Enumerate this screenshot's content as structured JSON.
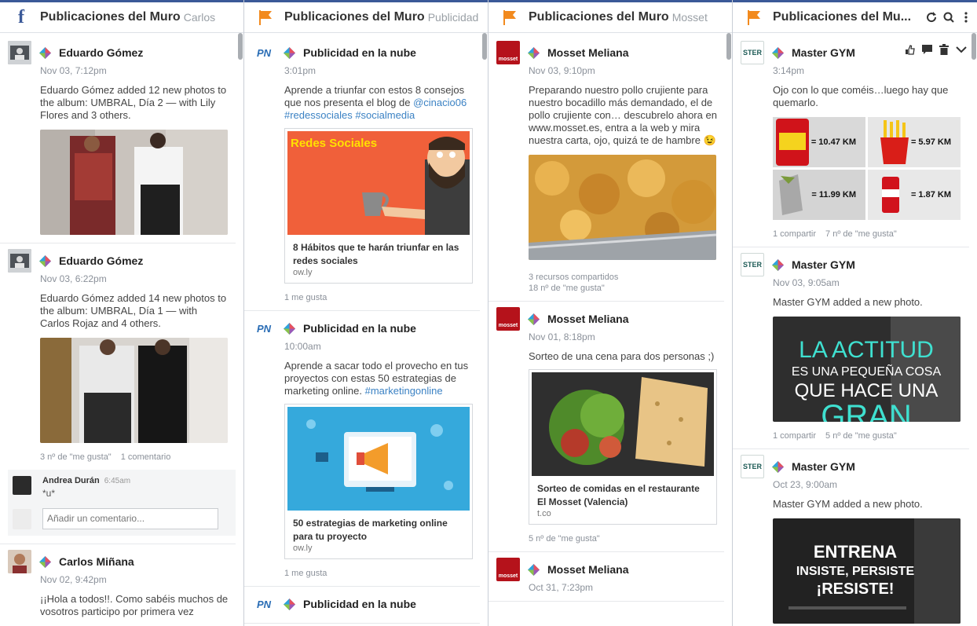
{
  "columns": [
    {
      "icon": "facebook-icon",
      "title": "Publicaciones del Muro",
      "subtitle": "Carlos",
      "posts": [
        {
          "author": "Eduardo Gómez",
          "time": "Nov 03, 7:12pm",
          "text": "Eduardo Gómez added 12 new photos to the album: UMBRAL, Día 2 — with Lily Flores and 3 others."
        },
        {
          "author": "Eduardo Gómez",
          "time": "Nov 03, 6:22pm",
          "text": "Eduardo Gómez added 14 new photos to the album: UMBRAL, Día 1 — with Carlos Rojaz and 4 others.",
          "likes": "3 nº de \"me gusta\"",
          "comments": "1 comentario",
          "comment": {
            "name": "Andrea Durán",
            "time": "6:45am",
            "text": "*u*"
          },
          "comment_placeholder": "Añadir un comentario..."
        },
        {
          "author": "Carlos Miñana",
          "time": "Nov 02, 9:42pm",
          "text": "¡¡Hola a todos!!. Como sabéis muchos de vosotros participo por primera vez"
        }
      ]
    },
    {
      "icon": "flag-icon",
      "title": "Publicaciones del Muro",
      "subtitle": "Publicidad",
      "posts": [
        {
          "author": "Publicidad en la nube",
          "time": "3:01pm",
          "text_plain": "Aprende a triunfar con estos 8 consejos que nos presenta el blog de ",
          "text_tags": "@cinacio06 #redessociales #socialmedia",
          "card_banner": "Redes Sociales",
          "card_title": "8 Hábitos que te harán triunfar en las redes sociales",
          "card_domain": "ow.ly",
          "likes": "1 me gusta"
        },
        {
          "author": "Publicidad en la nube",
          "time": "10:00am",
          "text_plain": "Aprende a sacar todo el provecho en tus proyectos con estas 50 estrategias de marketing online. ",
          "text_tags": "#marketingonline",
          "card_title": "50 estrategias de marketing online para tu proyecto",
          "card_domain": "ow.ly",
          "likes": "1 me gusta"
        },
        {
          "author": "Publicidad en la nube",
          "time": ""
        }
      ]
    },
    {
      "icon": "flag-icon",
      "title": "Publicaciones del Muro",
      "subtitle": "Mosset",
      "posts": [
        {
          "author": "Mosset Meliana",
          "time": "Nov 03, 9:10pm",
          "text": "Preparando nuestro pollo crujiente para nuestro bocadillo más demandado, el de pollo crujiente con… descubrelo ahora en www.mosset.es, entra a la web y mira nuestra carta, ojo, quizá te de hambre 😉",
          "shares": "3 recursos compartidos",
          "likes": "18 nº de \"me gusta\""
        },
        {
          "author": "Mosset Meliana",
          "time": "Nov 01, 8:18pm",
          "text": "Sorteo de una cena para dos personas ;)",
          "card_title": "Sorteo de comidas en el restaurante El Mosset (Valencia)",
          "card_domain": "t.co",
          "likes": "5 nº de \"me gusta\""
        },
        {
          "author": "Mosset Meliana",
          "time": "Oct 31, 7:23pm"
        }
      ]
    },
    {
      "icon": "flag-icon",
      "title": "Publicaciones del Mu...",
      "subtitle": "",
      "posts": [
        {
          "author": "Master GYM",
          "time": "3:14pm",
          "text": "Ojo con lo que coméis…luego hay que quemarlo.",
          "grid_labels": [
            "= 10.47 KM",
            "= 5.97 KM",
            "= 11.99 KM",
            "= 1.87 KM"
          ],
          "shares": "1 compartir",
          "likes": "7 nº de \"me gusta\""
        },
        {
          "author": "Master GYM",
          "time": "Nov 03, 9:05am",
          "text": "Master GYM added a new photo.",
          "image_text_1": "LA ACTITUD",
          "image_text_2": "ES UNA PEQUEÑA COSA",
          "image_text_3": "QUE HACE UNA",
          "image_text_4": "GRAN",
          "shares": "1 compartir",
          "likes": "5 nº de \"me gusta\""
        },
        {
          "author": "Master GYM",
          "time": "Oct 23, 9:00am",
          "text": "Master GYM added a new photo.",
          "image_text_1": "ENTRENA",
          "image_text_2": "INSISTE, PERSISTE",
          "image_text_3": "¡RESISTE!"
        }
      ]
    }
  ],
  "avatars": {
    "publicidad": "PN",
    "mosset": "mosset",
    "gym": "STER"
  },
  "colors": {
    "facebook": "#3b5998",
    "flag": "#f28a1e",
    "link": "#3b82c4"
  }
}
